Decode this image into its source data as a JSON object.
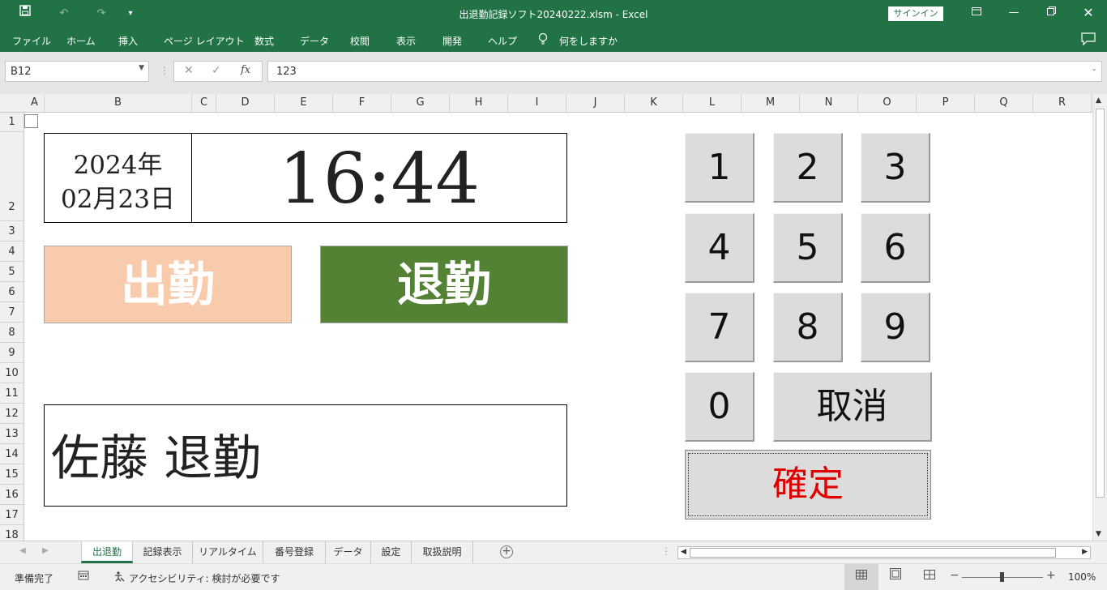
{
  "titlebar": {
    "title": "出退勤記録ソフト20240222.xlsm  -  Excel",
    "signin_label": "サインイン"
  },
  "ribbon": {
    "tabs": [
      "ファイル",
      "ホーム",
      "挿入",
      "ページ レイアウト",
      "数式",
      "データ",
      "校閲",
      "表示",
      "開発",
      "ヘルプ"
    ],
    "tell_me": "何をしますか"
  },
  "formula_bar": {
    "name_box": "B12",
    "formula": "123"
  },
  "columns": [
    "A",
    "B",
    "C",
    "D",
    "E",
    "F",
    "G",
    "H",
    "I",
    "J",
    "K",
    "L",
    "M",
    "N",
    "O",
    "P",
    "Q",
    "R"
  ],
  "rows": [
    "1",
    "2",
    "3",
    "4",
    "5",
    "6",
    "7",
    "8",
    "9",
    "10",
    "11",
    "12",
    "13",
    "14",
    "15",
    "16",
    "17",
    "18"
  ],
  "sheet": {
    "date_year": "2024年",
    "date_md": "02月23日",
    "time": "16:44",
    "clock_in_label": "出勤",
    "clock_out_label": "退勤",
    "message": "佐藤 退勤",
    "colors": {
      "clock_in": "#f8cbad",
      "clock_out": "#548235",
      "confirm_text": "#e00000",
      "excel_green": "#217346"
    }
  },
  "keypad": {
    "keys": [
      "1",
      "2",
      "3",
      "4",
      "5",
      "6",
      "7",
      "8",
      "9",
      "0"
    ],
    "cancel_label": "取消",
    "confirm_label": "確定"
  },
  "sheet_tabs": [
    "出退勤",
    "記録表示",
    "リアルタイム",
    "番号登録",
    "データ",
    "設定",
    "取扱説明"
  ],
  "status": {
    "ready": "準備完了",
    "accessibility": "アクセシビリティ: 検討が必要です",
    "zoom": "100%"
  },
  "icons": {
    "save": "save-icon",
    "undo": "undo-icon",
    "redo": "redo-icon",
    "lightbulb": "lightbulb-icon",
    "comments": "comment-icon"
  }
}
